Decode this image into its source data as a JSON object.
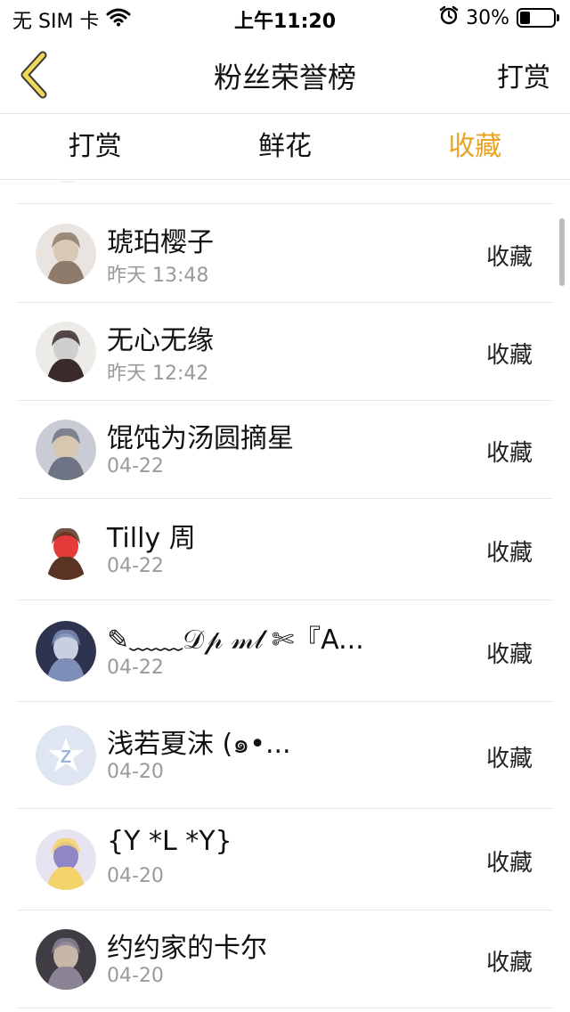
{
  "status_bar": {
    "carrier": "无 SIM 卡",
    "time": "上午11:20",
    "battery": "30%",
    "battery_level": 0.3,
    "icons": [
      "wifi-icon",
      "alarm-icon",
      "battery-icon"
    ]
  },
  "nav": {
    "back_icon": "chevron-left-icon",
    "title": "粉丝荣誉榜",
    "action": "打赏"
  },
  "tabs": [
    {
      "label": "打赏",
      "active": false
    },
    {
      "label": "鲜花",
      "active": false
    },
    {
      "label": "收藏",
      "active": true
    }
  ],
  "colors": {
    "accent": "#e9a325",
    "back_icon_fill": "#f0da55",
    "divider": "#e6e6e6",
    "secondary_text": "#9a9a9a"
  },
  "rows": [
    {
      "name": "琥珀樱子",
      "time": "昨天 13:48",
      "action": "收藏"
    },
    {
      "name": "无心无缘",
      "time": "昨天 12:42",
      "action": "收藏"
    },
    {
      "name": "馄饨为汤圆摘星",
      "time": "04-22",
      "action": "收藏"
    },
    {
      "name": "Tilly 周",
      "time": "04-22",
      "action": "收藏"
    },
    {
      "name": "✎﹏﹏𝒟𝓅 𝓂𝓁 ✄『A...",
      "time": "04-22",
      "action": "收藏"
    },
    {
      "name": "浅若夏沫 (๑•...",
      "time": "04-20",
      "action": "收藏"
    },
    {
      "name": "{Y *L *Y}",
      "time": "04-20",
      "action": "收藏"
    },
    {
      "name": "约约家的卡尔",
      "time": "04-20",
      "action": "收藏"
    }
  ]
}
